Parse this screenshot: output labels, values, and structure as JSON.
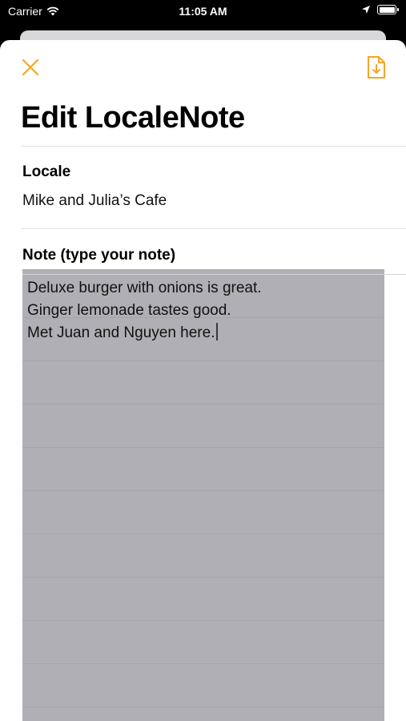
{
  "status_bar": {
    "carrier": "Carrier",
    "time": "11:05 AM"
  },
  "icons": {
    "close": "close-icon",
    "export": "document-download-icon",
    "wifi": "wifi-icon",
    "location": "location-arrow-icon",
    "battery": "battery-icon"
  },
  "colors": {
    "accent": "#F5A623",
    "note_highlight": "#B0AFB5"
  },
  "page": {
    "title": "Edit LocaleNote"
  },
  "locale": {
    "label": "Locale",
    "value": "Mike and Julia’s Cafe"
  },
  "note": {
    "label": "Note (type your note)",
    "lines": [
      "Deluxe burger with onions is great.",
      "Ginger lemonade tastes good.",
      "Met Juan and Nguyen here."
    ]
  }
}
